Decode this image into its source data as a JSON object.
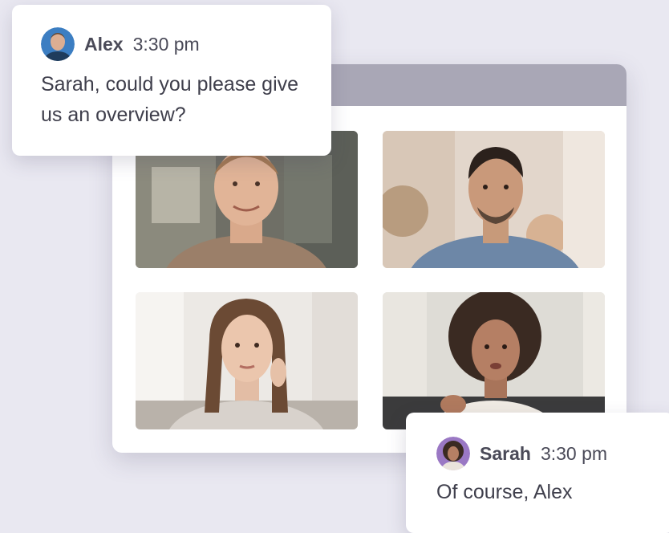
{
  "call_window": {
    "participants": [
      {
        "tile": "participant-1"
      },
      {
        "tile": "participant-2"
      },
      {
        "tile": "participant-3"
      },
      {
        "tile": "participant-4"
      }
    ]
  },
  "messages": [
    {
      "sender": "Alex",
      "time": "3:30 pm",
      "text": "Sarah, could you please give us an overview?"
    },
    {
      "sender": "Sarah",
      "time": "3:30 pm",
      "text": "Of course, Alex"
    }
  ],
  "colors": {
    "background": "#e9e8f1",
    "window_bar": "#a9a7b6",
    "text": "#4a4a58"
  }
}
